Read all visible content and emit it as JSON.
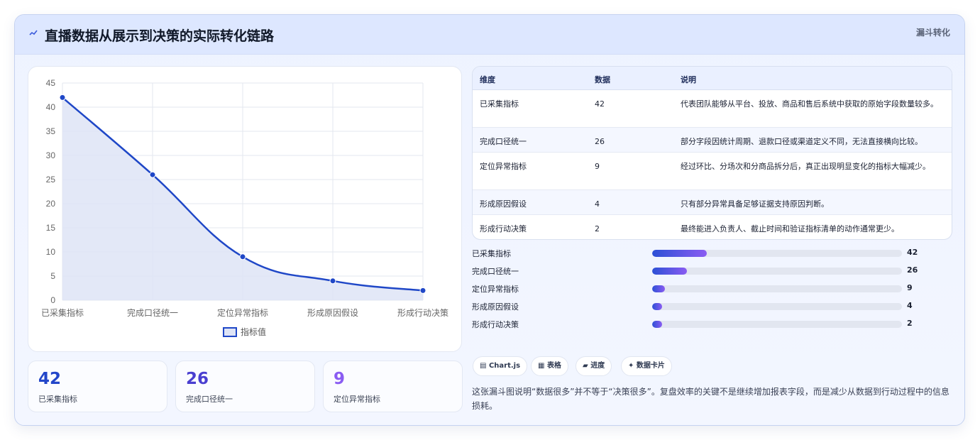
{
  "header": {
    "icon": "sparkline-icon",
    "title": "直播数据从展示到决策的实际转化链路",
    "tag": "漏斗转化"
  },
  "chart_data": {
    "type": "line",
    "categories": [
      "已采集指标",
      "完成口径统一",
      "定位异常指标",
      "形成原因假设",
      "形成行动决策"
    ],
    "series": [
      {
        "name": "指标值",
        "values": [
          42,
          26,
          9,
          4,
          2
        ]
      }
    ],
    "ylim": [
      0,
      45
    ],
    "yticks": [
      0,
      5,
      10,
      15,
      20,
      25,
      30,
      35,
      40,
      45
    ],
    "grid": true,
    "area_fill": true,
    "legend_position": "bottom",
    "colors": {
      "line": "#1f47c7",
      "fill": "#dee4f6"
    }
  },
  "stats": [
    {
      "value": "42",
      "label": "已采集指标",
      "color": "#2346c9"
    },
    {
      "value": "26",
      "label": "完成口径统一",
      "color": "#4a3fd0"
    },
    {
      "value": "9",
      "label": "定位异常指标",
      "color": "#8a5cf2"
    }
  ],
  "table": {
    "headers": [
      "维度",
      "数据",
      "说明"
    ],
    "rows": [
      {
        "dim": "已采集指标",
        "value": "42",
        "desc": "代表团队能够从平台、投放、商品和售后系统中获取的原始字段数量较多。"
      },
      {
        "dim": "完成口径统一",
        "value": "26",
        "desc": "部分字段因统计周期、退款口径或渠道定义不同，无法直接横向比较。"
      },
      {
        "dim": "定位异常指标",
        "value": "9",
        "desc": "经过环比、分场次和分商品拆分后，真正出现明显变化的指标大幅减少。"
      },
      {
        "dim": "形成原因假设",
        "value": "4",
        "desc": "只有部分异常具备足够证据支持原因判断。"
      },
      {
        "dim": "形成行动决策",
        "value": "2",
        "desc": "最终能进入负责人、截止时间和验证指标清单的动作通常更少。"
      }
    ]
  },
  "progress": {
    "max": 42,
    "items": [
      {
        "label": "已采集指标",
        "value": 42,
        "text": "42",
        "fraction": 0.22
      },
      {
        "label": "完成口径统一",
        "value": 26,
        "text": "26",
        "fraction": 0.14
      },
      {
        "label": "定位异常指标",
        "value": 9,
        "text": "9",
        "fraction": 0.05
      },
      {
        "label": "形成原因假设",
        "value": 4,
        "text": "4",
        "fraction": 0.04
      },
      {
        "label": "形成行动决策",
        "value": 2,
        "text": "2",
        "fraction": 0.04
      }
    ]
  },
  "chips": [
    {
      "icon": "chart-icon",
      "glyph": "▤",
      "label": "Chart.js"
    },
    {
      "icon": "table-icon",
      "glyph": "▦",
      "label": "表格"
    },
    {
      "icon": "progress-icon",
      "glyph": "▰",
      "label": "进度"
    },
    {
      "icon": "sparkle-icon",
      "glyph": "✦",
      "label": "数据卡片"
    }
  ],
  "note": "这张漏斗图说明“数据很多”并不等于“决策很多”。复盘效率的关键不是继续增加报表字段，而是减少从数据到行动过程中的信息损耗。"
}
